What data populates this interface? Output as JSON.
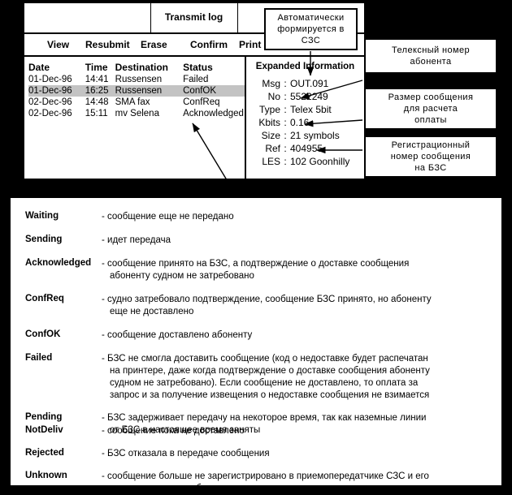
{
  "window": {
    "title": "Transmit log",
    "menu": [
      "View",
      "Resubmit",
      "Erase",
      "Confirm",
      "Print"
    ]
  },
  "log_table": {
    "headers": [
      "Date",
      "Time",
      "Destination",
      "Status"
    ],
    "rows": [
      {
        "date": "01-Dec-96",
        "time": "14:41",
        "destination": "Russensen",
        "status": "Failed",
        "selected": false
      },
      {
        "date": "01-Dec-96",
        "time": "16:25",
        "destination": "Russensen",
        "status": "ConfOK",
        "selected": true
      },
      {
        "date": "02-Dec-96",
        "time": "14:48",
        "destination": "SMA fax",
        "status": "ConfReq",
        "selected": false
      },
      {
        "date": "02-Dec-96",
        "time": "15:11",
        "destination": "mv Selena",
        "status": "Acknowledged",
        "selected": false
      }
    ]
  },
  "expanded_info": {
    "title": "Expanded Information",
    "fields": [
      {
        "key": "Msg",
        "value": "OUT.091"
      },
      {
        "key": "No",
        "value": "5522249"
      },
      {
        "key": "Type",
        "value": "Telex 5bit"
      },
      {
        "key": "Kbits",
        "value": "0.16"
      },
      {
        "key": "Size",
        "value": "21 symbols"
      },
      {
        "key": "Ref",
        "value": "404955"
      },
      {
        "key": "LES",
        "value": "102 Goonhilly"
      }
    ]
  },
  "callouts": {
    "auto": [
      "Автоматически",
      "формируется в",
      "СЗС"
    ],
    "telex": [
      "Телексный номер",
      "абонента"
    ],
    "size": [
      "Размер сообщения",
      "для расчета",
      "оплаты"
    ],
    "reg": [
      "Регистрационный",
      "номер  сообщения",
      "на БЗС"
    ]
  },
  "legend": {
    "items": [
      {
        "term": "Waiting",
        "lines": [
          "- сообщение еще не передано"
        ]
      },
      {
        "term": "Sending",
        "lines": [
          "- идет передача"
        ]
      },
      {
        "term": "Acknowledged",
        "lines": [
          "- сообщение принято на БЗС, а подтверждение о доставке сообщения",
          "абоненту судном не затребовано"
        ]
      },
      {
        "term": "ConfReq",
        "lines": [
          "- судно затребовало подтверждение, сообщение БЗС принято, но абоненту",
          "еще не доставлено"
        ]
      },
      {
        "term": "ConfOK",
        "lines": [
          "- сообщение доставлено абоненту"
        ]
      },
      {
        "term": "Failed",
        "lines": [
          "- БЗС не смогла доставить сообщение (код о недоставке будет распечатан",
          "на  принтере,  даже  когда  подтверждение  о  доставке  сообщения абоненту",
          "судном не затребовано). Если сообщение не доставлено, то оплата за",
          "запрос и за получение извещения о недоставке сообщения не взимается"
        ]
      },
      {
        "term": "Pending",
        "lines": [
          "- БЗС задерживает передачу на некоторое время, так как наземные линии",
          "от БЗС в настоящее время заняты"
        ]
      },
      {
        "term": "NotDeliv",
        "lines": [
          "- сообщение пока не доставлено"
        ]
      },
      {
        "term": "Rejected",
        "lines": [
          "- БЗС отказала в передаче сообщения"
        ]
      },
      {
        "term": "Unknown",
        "lines": [
          "- сообщение больше не зарегистрировано в приемопередатчике СЗС и его",
          "окончательная судьба не известна."
        ]
      }
    ]
  },
  "colors": {
    "background": "#000000",
    "panel": "#ffffff",
    "border": "#000000",
    "selection": "#c3c3c3"
  }
}
